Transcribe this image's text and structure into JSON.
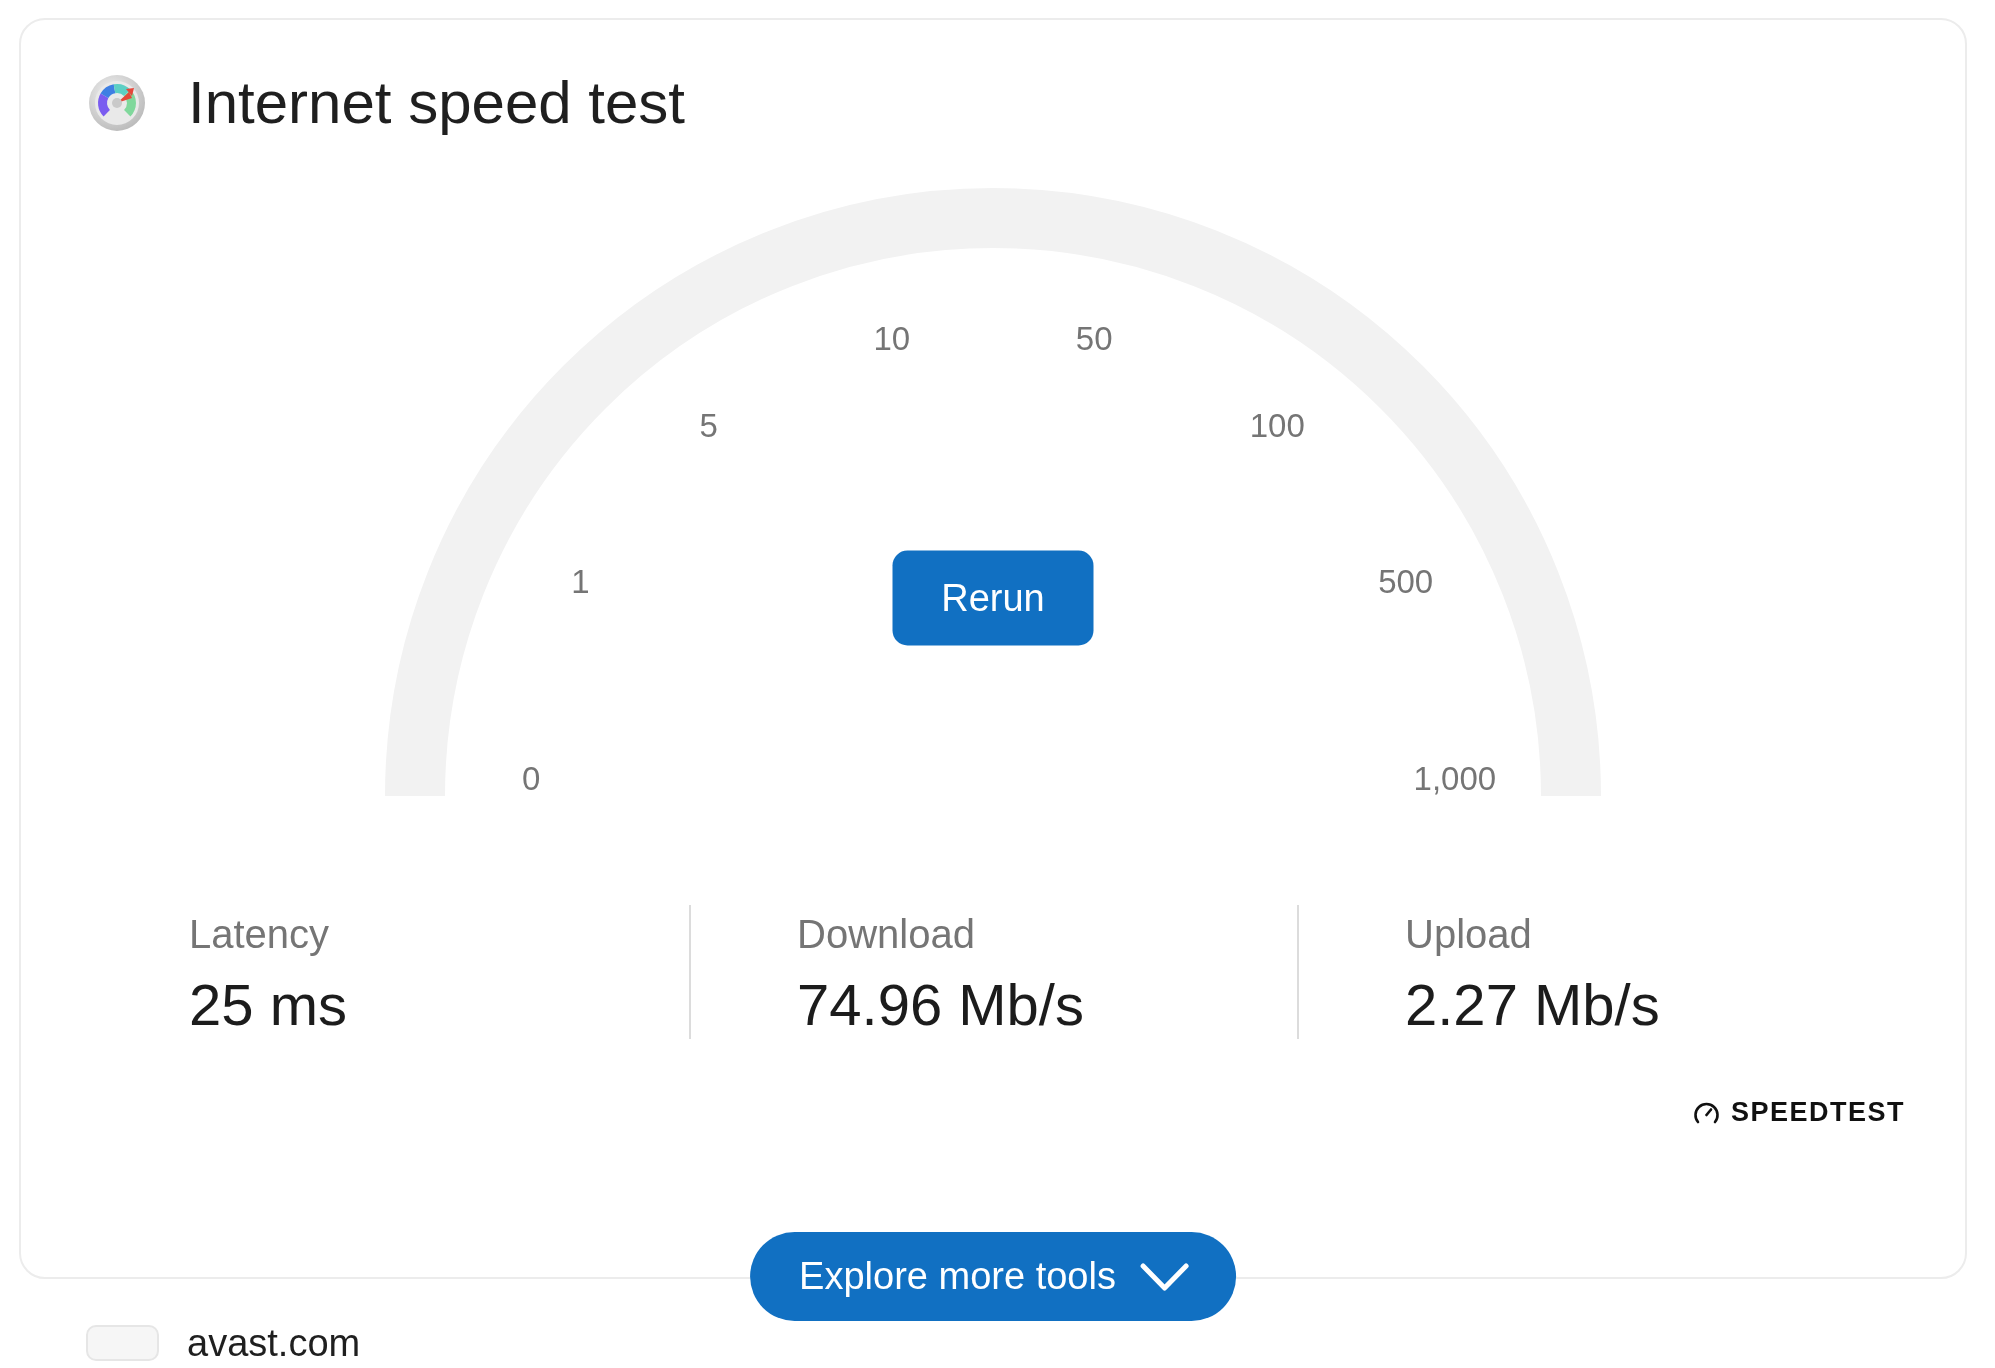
{
  "header": {
    "title": "Internet speed test"
  },
  "gauge": {
    "scale": [
      "0",
      "1",
      "5",
      "10",
      "50",
      "100",
      "500",
      "1,000"
    ],
    "button": "Rerun"
  },
  "stats": [
    {
      "label": "Latency",
      "value": "25 ms"
    },
    {
      "label": "Download",
      "value": "74.96 Mb/s"
    },
    {
      "label": "Upload",
      "value": "2.27 Mb/s"
    }
  ],
  "attribution": "SPEEDTEST",
  "explore_button": {
    "label": "Explore more tools"
  },
  "next_result": {
    "site": "avast.com"
  }
}
